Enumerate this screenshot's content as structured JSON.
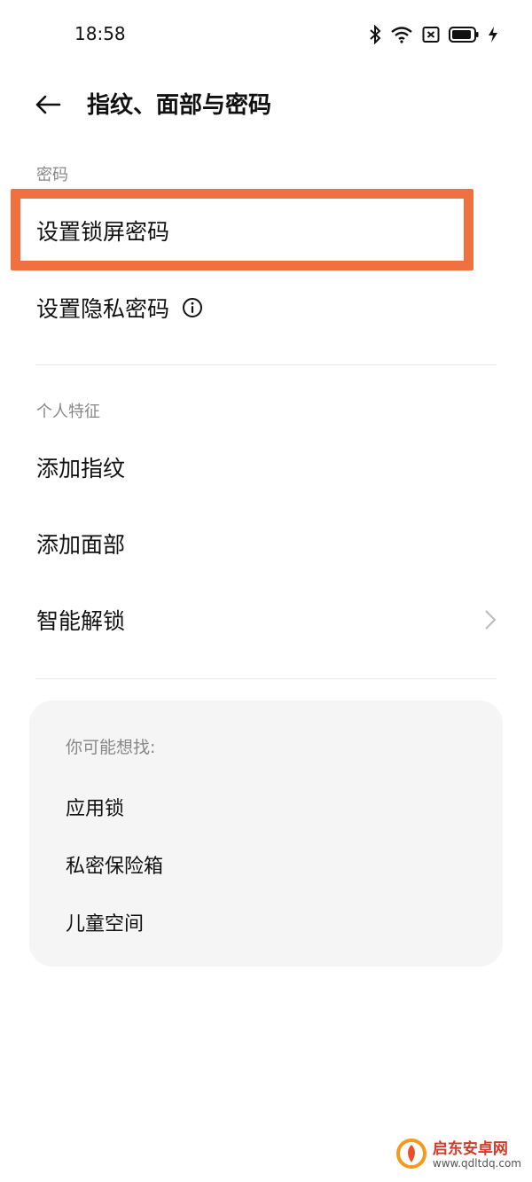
{
  "status_bar": {
    "time": "18:58",
    "icons": [
      "bluetooth-icon",
      "wifi-icon",
      "sim-off-icon",
      "battery-icon",
      "charging-icon"
    ]
  },
  "header": {
    "title": "指纹、面部与密码",
    "back_icon": "arrow-left-icon"
  },
  "password_section": {
    "label": "密码",
    "items": [
      {
        "label": "设置锁屏密码",
        "highlighted": true
      },
      {
        "label": "设置隐私密码",
        "info_icon": "info-circle-icon"
      }
    ]
  },
  "biometrics_section": {
    "label": "个人特征",
    "items": [
      {
        "label": "添加指纹"
      },
      {
        "label": "添加面部"
      },
      {
        "label": "智能解锁",
        "chevron": "chevron-right-icon"
      }
    ]
  },
  "suggestions": {
    "title": "你可能想找:",
    "items": [
      "应用锁",
      "私密保险箱",
      "儿童空间"
    ]
  },
  "watermark": {
    "name": "启东安卓网",
    "url": "www.qdltdq.com"
  },
  "colors": {
    "highlight": "#f07140",
    "card_bg": "#f5f5f5",
    "muted_text": "#888888"
  }
}
